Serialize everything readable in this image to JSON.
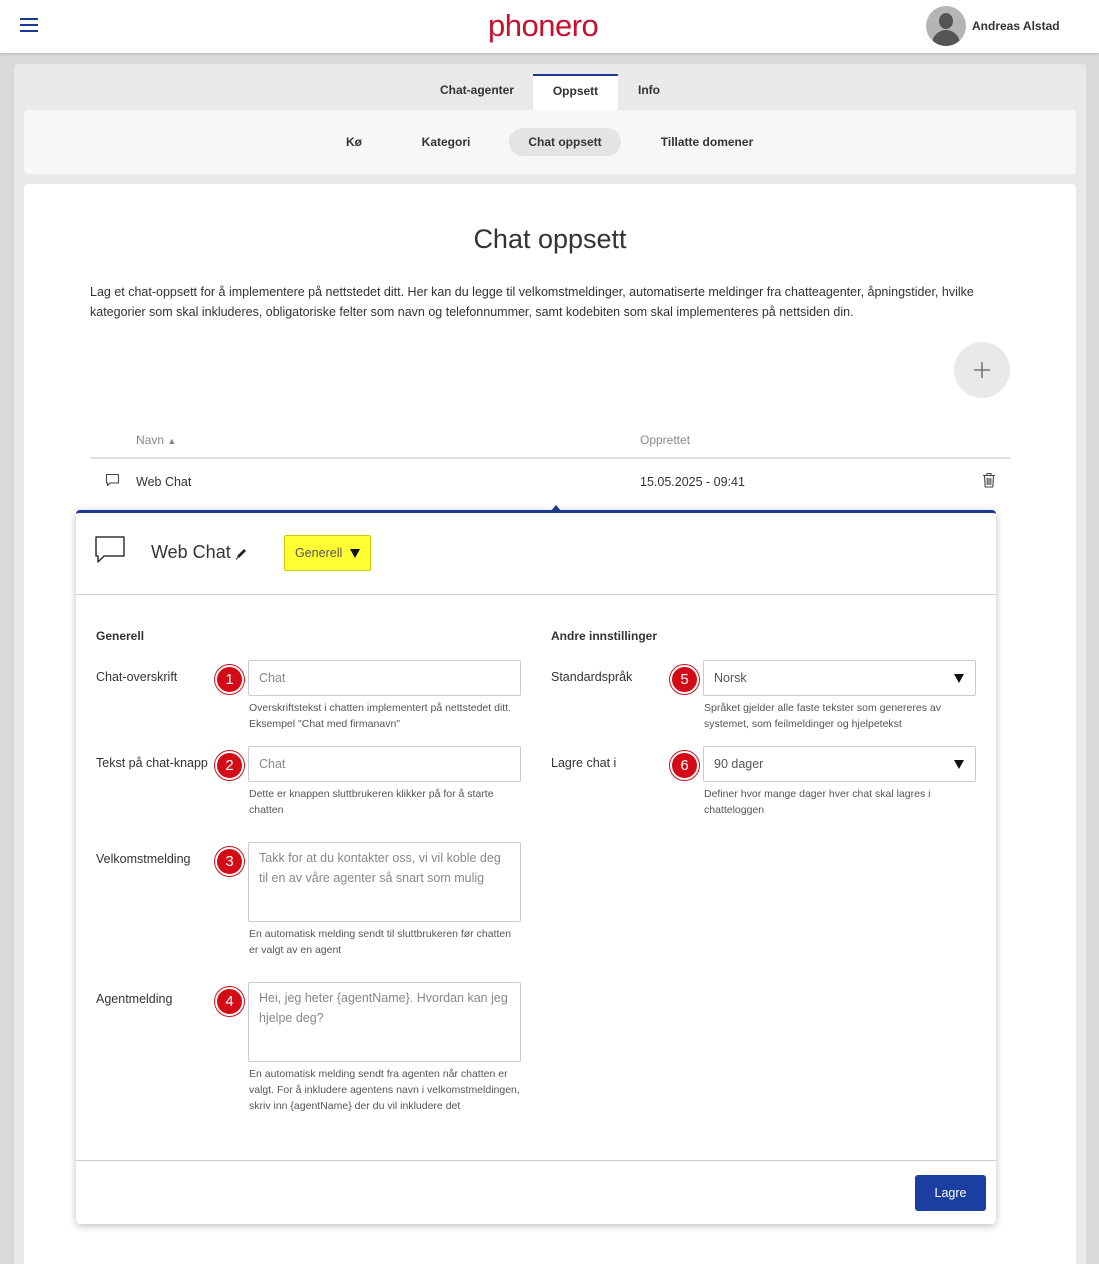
{
  "header": {
    "logo": "phonero",
    "user_name": "Andreas Alstad",
    "brand_color": "#c8102e"
  },
  "tabs": [
    "Chat-agenter",
    "Oppsett",
    "Info"
  ],
  "active_tab": "Oppsett",
  "subnav": [
    "Kø",
    "Kategori",
    "Chat oppsett",
    "Tillatte domener"
  ],
  "active_subnav": "Chat oppsett",
  "page": {
    "title": "Chat oppsett",
    "description": "Lag et chat-oppsett for å implementere på nettstedet ditt. Her kan du legge til velkomstmeldinger, automatiserte meldinger fra chatteagenter, åpningstider, hvilke kategorier som skal inkluderes, obligatoriske felter som navn og telefonnummer, samt kodebiten som skal implementeres på nettsiden din."
  },
  "table": {
    "col_name": "Navn",
    "col_created": "Opprettet",
    "rows": [
      {
        "name": "Web Chat",
        "created": "15.05.2025 - 09:41"
      }
    ]
  },
  "detail": {
    "title": "Web Chat",
    "view_select": "Generell",
    "left_section": "Generell",
    "right_section": "Andre innstillinger",
    "fields": {
      "heading": {
        "label": "Chat-overskrift",
        "badge": "1",
        "placeholder": "Chat",
        "help": "Overskriftstekst i chatten implementert på nettstedet ditt. Eksempel \"Chat med firmanavn\""
      },
      "button_text": {
        "label": "Tekst på chat-knapp",
        "badge": "2",
        "placeholder": "Chat",
        "help": "Dette er knappen sluttbrukeren klikker på for å starte chatten"
      },
      "welcome": {
        "label": "Velkomstmelding",
        "badge": "3",
        "placeholder": "Takk for at du kontakter oss, vi vil koble deg til en av våre agenter så snart som mulig",
        "help": "En automatisk melding sendt til sluttbrukeren før chatten er valgt av en agent"
      },
      "agent": {
        "label": "Agentmelding",
        "badge": "4",
        "placeholder": "Hei, jeg heter {agentName}. Hvordan kan jeg hjelpe deg?",
        "help": "En automatisk melding sendt fra agenten når chatten er valgt. For å inkludere agentens navn i velkomstmeldingen, skriv inn {agentName} der du vil inkludere det"
      },
      "language": {
        "label": "Standardspråk",
        "badge": "5",
        "value": "Norsk",
        "help": "Språket gjelder alle faste tekster som genereres av systemet, som feilmeldinger og hjelpetekst"
      },
      "retention": {
        "label": "Lagre chat i",
        "badge": "6",
        "value": "90 dager",
        "help": "Definer hvor mange dager hver chat skal lagres i chatteloggen"
      }
    },
    "save_label": "Lagre",
    "accent_color": "#1a3a8f",
    "highlight_color": "#ffff33",
    "badge_color": "#d40b16"
  }
}
